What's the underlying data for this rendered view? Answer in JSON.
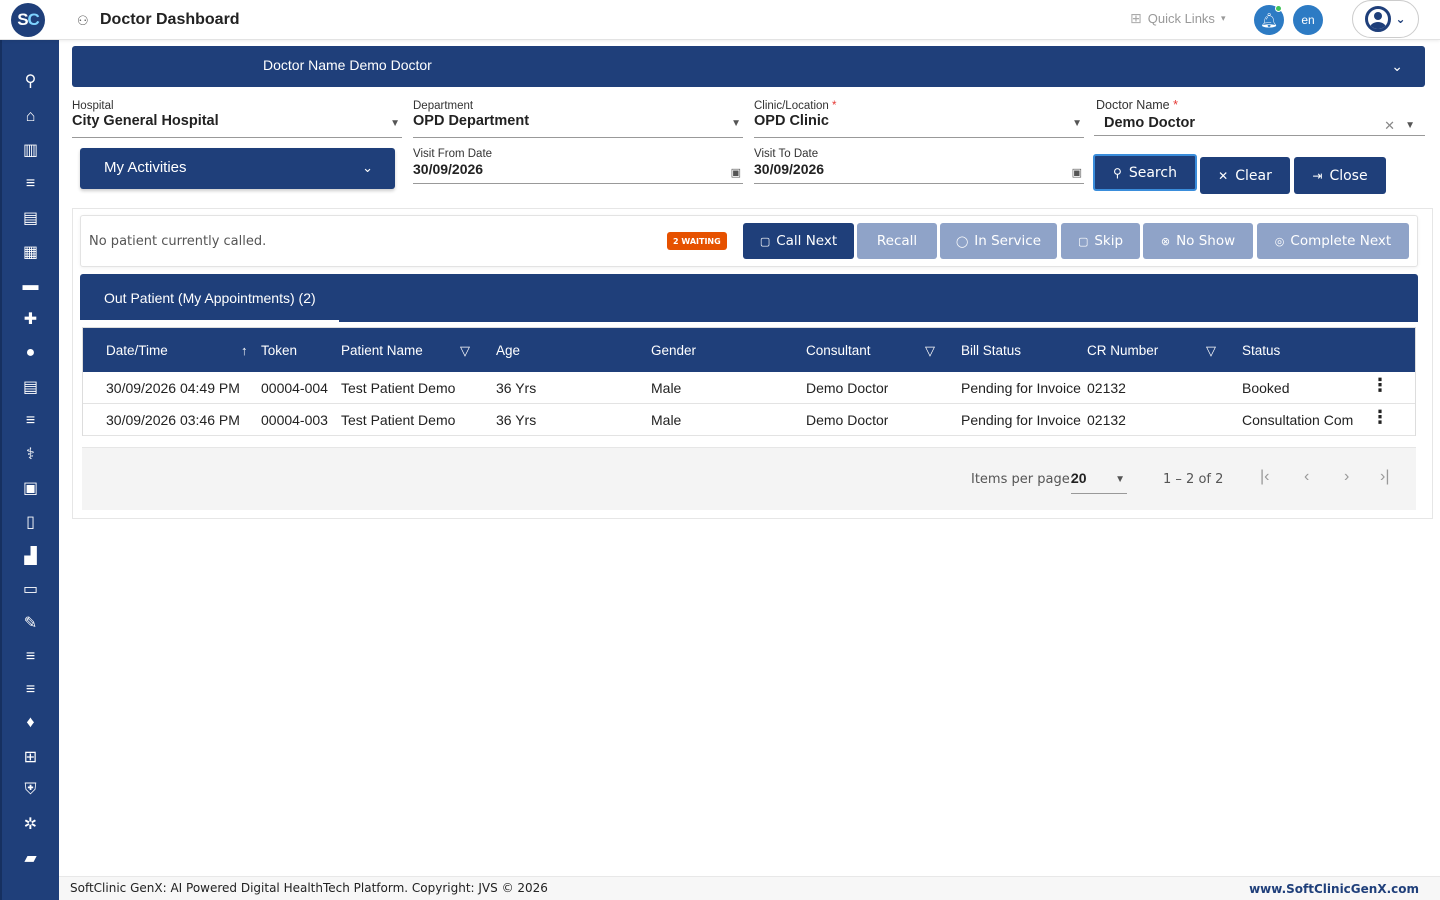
{
  "header": {
    "logo_text": "SC",
    "title": "Doctor Dashboard",
    "title_icon": "doctor-icon",
    "quick_links": "Quick Links",
    "language": "en"
  },
  "sidebar": {
    "items": [
      {
        "icon": "search-icon",
        "glyph": "⚲"
      },
      {
        "icon": "home-icon",
        "glyph": "⌂"
      },
      {
        "icon": "bar-chart-icon",
        "glyph": "▥"
      },
      {
        "icon": "menu-icon",
        "glyph": "≡"
      },
      {
        "icon": "badge-icon",
        "glyph": "▤"
      },
      {
        "icon": "calendar-icon",
        "glyph": "▦"
      },
      {
        "icon": "bed-icon",
        "glyph": "▬"
      },
      {
        "icon": "medical-plus-icon",
        "glyph": "✚"
      },
      {
        "icon": "person-icon",
        "glyph": "●"
      },
      {
        "icon": "document-icon",
        "glyph": "▤"
      },
      {
        "icon": "list-icon",
        "glyph": "≡"
      },
      {
        "icon": "pharmacy-icon",
        "glyph": "⚕"
      },
      {
        "icon": "medicine-box-icon",
        "glyph": "▣"
      },
      {
        "icon": "book-icon",
        "glyph": "▯"
      },
      {
        "icon": "building-icon",
        "glyph": "▟"
      },
      {
        "icon": "devices-icon",
        "glyph": "▭"
      },
      {
        "icon": "wrench-icon",
        "glyph": "✎"
      },
      {
        "icon": "list-icon",
        "glyph": "≡"
      },
      {
        "icon": "list-icon",
        "glyph": "≡"
      },
      {
        "icon": "blood-drop-icon",
        "glyph": "♦"
      },
      {
        "icon": "add-box-icon",
        "glyph": "⊞"
      },
      {
        "icon": "shield-icon",
        "glyph": "⛨"
      },
      {
        "icon": "network-icon",
        "glyph": "✲"
      },
      {
        "icon": "folder-icon",
        "glyph": "▰"
      }
    ]
  },
  "doctor_banner": {
    "text": "Doctor Name Demo Doctor"
  },
  "filters": {
    "hospital_label": "Hospital",
    "hospital_value": "City General Hospital",
    "department_label": "Department",
    "department_value": "OPD Department",
    "clinic_label": "Clinic/Location",
    "clinic_value": "OPD Clinic",
    "doctor_label": "Doctor Name",
    "doctor_value": "Demo Doctor",
    "required_mark": "*",
    "visit_from_label": "Visit From Date",
    "visit_from_value": "30/09/2026",
    "visit_to_label": "Visit To Date",
    "visit_to_value": "30/09/2026"
  },
  "activities": {
    "label": "My Activities"
  },
  "actions": {
    "search": "Search",
    "clear": "Clear",
    "close": "Close"
  },
  "queue": {
    "message": "No patient currently called.",
    "badge": "2 WAITING",
    "call_next": "Call Next",
    "recall": "Recall",
    "in_service": "In Service",
    "skip": "Skip",
    "no_show": "No Show",
    "complete_next": "Complete Next"
  },
  "tabs": {
    "active": "Out Patient (My Appointments) (2)"
  },
  "table": {
    "columns": [
      "Date/Time",
      "Token",
      "Patient Name",
      "Age",
      "Gender",
      "Consultant",
      "Bill Status",
      "CR Number",
      "Status"
    ],
    "rows": [
      [
        "30/09/2026 04:49 PM",
        "00004-004",
        "Test Patient Demo",
        "36 Yrs",
        "Male",
        "Demo Doctor",
        "Pending for Invoice",
        "02132",
        "Booked"
      ],
      [
        "30/09/2026 03:46 PM",
        "00004-003",
        "Test Patient Demo",
        "36 Yrs",
        "Male",
        "Demo Doctor",
        "Pending for Invoice",
        "02132",
        "Consultation Com"
      ]
    ]
  },
  "pager": {
    "items_per_page_label": "Items per page:",
    "items_per_page_value": "20",
    "range": "1 – 2 of 2"
  },
  "footer": {
    "copyright": "SoftClinic GenX: AI Powered Digital HealthTech Platform. Copyright: JVS © 2026",
    "website": "www.SoftClinicGenX.com"
  },
  "colors": {
    "primary": "#1f3f7a",
    "accent": "#2d7bc4",
    "disabled": "#8fa3c8",
    "badge": "#e65100"
  }
}
